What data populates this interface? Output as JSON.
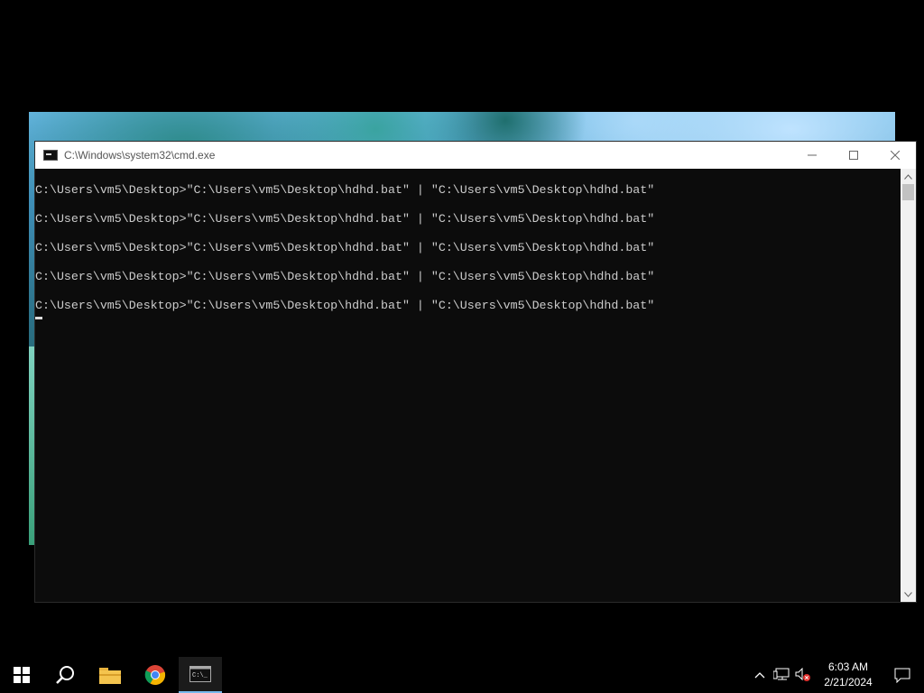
{
  "window": {
    "title": "C:\\Windows\\system32\\cmd.exe"
  },
  "console": {
    "lines": [
      "C:\\Users\\vm5\\Desktop>\"C:\\Users\\vm5\\Desktop\\hdhd.bat\" | \"C:\\Users\\vm5\\Desktop\\hdhd.bat\"",
      "C:\\Users\\vm5\\Desktop>\"C:\\Users\\vm5\\Desktop\\hdhd.bat\" | \"C:\\Users\\vm5\\Desktop\\hdhd.bat\"",
      "C:\\Users\\vm5\\Desktop>\"C:\\Users\\vm5\\Desktop\\hdhd.bat\" | \"C:\\Users\\vm5\\Desktop\\hdhd.bat\"",
      "C:\\Users\\vm5\\Desktop>\"C:\\Users\\vm5\\Desktop\\hdhd.bat\" | \"C:\\Users\\vm5\\Desktop\\hdhd.bat\"",
      "C:\\Users\\vm5\\Desktop>\"C:\\Users\\vm5\\Desktop\\hdhd.bat\" | \"C:\\Users\\vm5\\Desktop\\hdhd.bat\""
    ]
  },
  "taskbar": {
    "items": [
      "start-icon",
      "search-icon",
      "file-explorer-icon",
      "chrome-icon",
      "cmd-icon"
    ],
    "tray_icons": [
      "chevron-up-icon",
      "network-icon",
      "volume-muted-icon"
    ],
    "clock_time": "6:03 AM",
    "clock_date": "2/21/2024"
  },
  "colors": {
    "console_bg": "#0c0c0c",
    "console_text": "#cccccc",
    "accent": "#76b9ed"
  }
}
